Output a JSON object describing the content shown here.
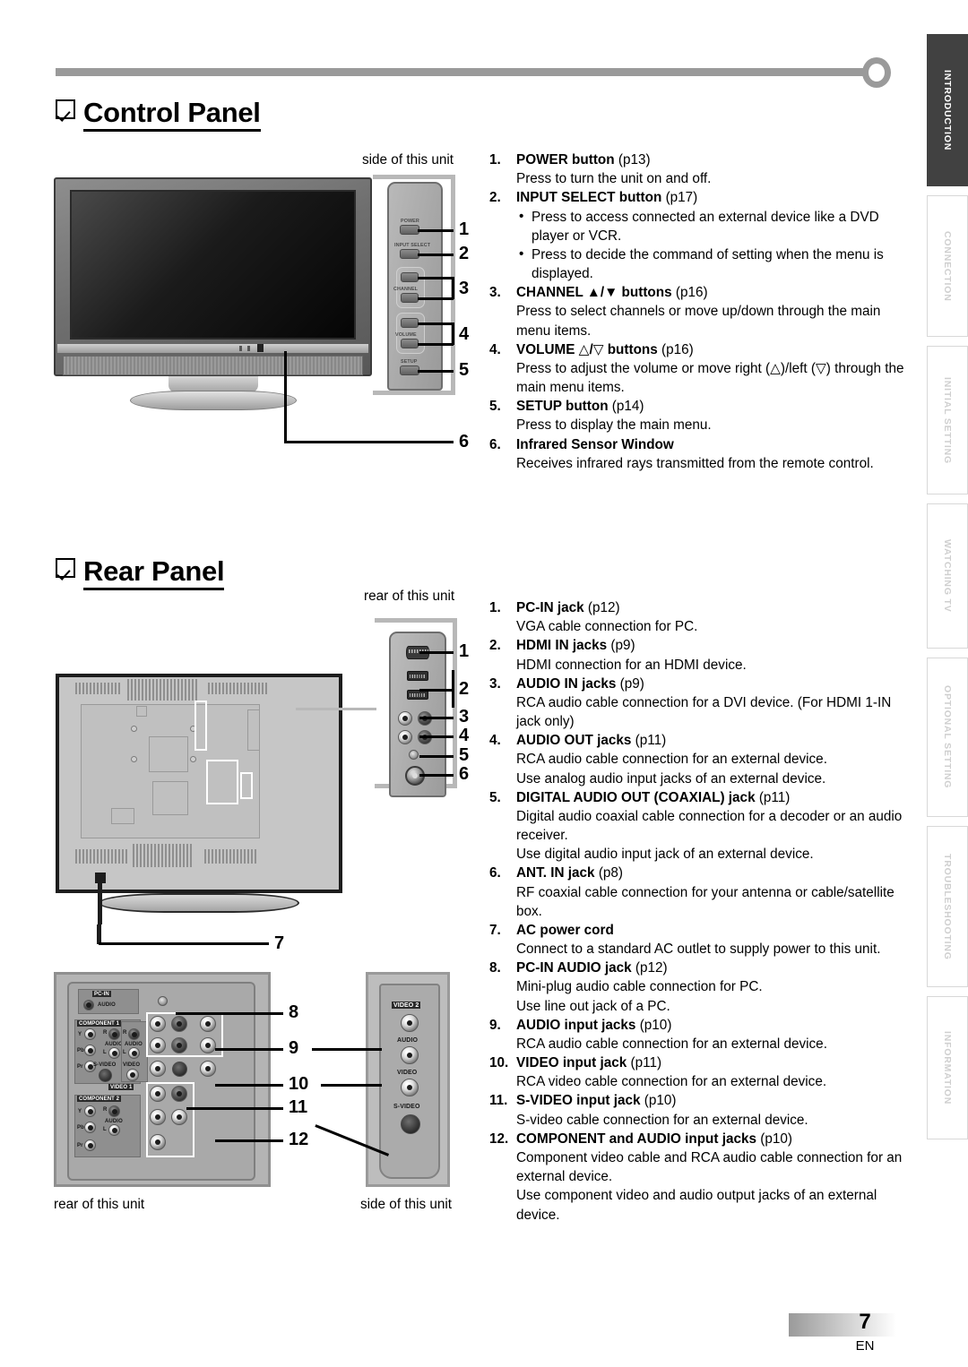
{
  "document": {
    "page_number": "7",
    "language_code": "EN"
  },
  "side_tabs": [
    {
      "label": "INTRODUCTION",
      "active": true
    },
    {
      "label": "CONNECTION",
      "active": false
    },
    {
      "label": "INITIAL  SETTING",
      "active": false
    },
    {
      "label": "WATCHING  TV",
      "active": false
    },
    {
      "label": "OPTIONAL  SETTING",
      "active": false
    },
    {
      "label": "TROUBLESHOOTING",
      "active": false
    },
    {
      "label": "INFORMATION",
      "active": false
    }
  ],
  "control_panel": {
    "heading": "Control Panel",
    "figure_caption": "side of this unit",
    "callouts": [
      "1",
      "2",
      "3",
      "4",
      "5",
      "6"
    ],
    "device_button_labels": {
      "power": "POWER",
      "input_select": "INPUT SELECT",
      "channel": "CHANNEL",
      "volume": "VOLUME",
      "setup": "SETUP"
    },
    "items": [
      {
        "num": "1.",
        "title": "POWER button",
        "page_ref": "(p13)",
        "lines": [
          "Press to turn the unit on and off."
        ]
      },
      {
        "num": "2.",
        "title": "INPUT SELECT button",
        "page_ref": "(p17)",
        "bullets": [
          "Press to access connected an external device like a DVD player or VCR.",
          "Press to decide the command of setting when the menu is displayed."
        ]
      },
      {
        "num": "3.",
        "title": "CHANNEL ▲/▼ buttons",
        "page_ref": "(p16)",
        "lines": [
          "Press to select channels or move up/down through the main menu items."
        ]
      },
      {
        "num": "4.",
        "title": "VOLUME △/▽ buttons",
        "page_ref": "(p16)",
        "lines": [
          "Press to adjust the volume or move right (△)/left (▽) through the main menu items."
        ]
      },
      {
        "num": "5.",
        "title": "SETUP button",
        "page_ref": "(p14)",
        "lines": [
          "Press to display the main menu."
        ]
      },
      {
        "num": "6.",
        "title": "Infrared Sensor Window",
        "page_ref": "",
        "lines": [
          "Receives infrared rays transmitted from the remote control."
        ]
      }
    ]
  },
  "rear_panel": {
    "heading": "Rear Panel",
    "figure_caption_top": "rear of this unit",
    "figure_caption_bottom_left": "rear of this unit",
    "figure_caption_bottom_right": "side of this unit",
    "callouts_top": [
      "1",
      "2",
      "3",
      "4",
      "5",
      "6",
      "7"
    ],
    "callouts_bottom": [
      "8",
      "9",
      "10",
      "11",
      "12"
    ],
    "jack_labels": {
      "pc_in": "PC-IN",
      "pc_in_audio": "AUDIO",
      "component1": "COMPONENT 1",
      "component2": "COMPONENT 2",
      "y": "Y",
      "pb": "Pb",
      "pr": "Pr",
      "audio": "AUDIO",
      "r": "R",
      "l": "L",
      "s_video": "S-VIDEO",
      "video": "VIDEO",
      "video1": "VIDEO 1",
      "video2": "VIDEO 2"
    },
    "items": [
      {
        "num": "1.",
        "title": "PC-IN jack",
        "page_ref": "(p12)",
        "lines": [
          "VGA cable connection for PC."
        ]
      },
      {
        "num": "2.",
        "title": "HDMI IN jacks",
        "page_ref": "(p9)",
        "lines": [
          "HDMI connection for an HDMI device."
        ]
      },
      {
        "num": "3.",
        "title": "AUDIO IN jacks",
        "page_ref": "(p9)",
        "lines": [
          "RCA audio cable connection for a DVI device. (For HDMI 1-IN jack only)"
        ]
      },
      {
        "num": "4.",
        "title": "AUDIO OUT jacks",
        "page_ref": "(p11)",
        "lines": [
          "RCA audio cable connection for an external device.",
          "Use analog audio input jacks of an external device."
        ]
      },
      {
        "num": "5.",
        "title": "DIGITAL AUDIO OUT (COAXIAL) jack",
        "page_ref": "(p11)",
        "lines": [
          "Digital audio coaxial cable connection for a decoder or an audio receiver.",
          "Use digital audio input jack of an external device."
        ]
      },
      {
        "num": "6.",
        "title": "ANT. IN jack",
        "page_ref": "(p8)",
        "lines": [
          "RF coaxial cable connection for your antenna or cable/satellite box."
        ]
      },
      {
        "num": "7.",
        "title": "AC power cord",
        "page_ref": "",
        "lines": [
          "Connect to a standard AC outlet to supply power to this unit."
        ]
      },
      {
        "num": "8.",
        "title": "PC-IN AUDIO jack",
        "page_ref": "(p12)",
        "lines": [
          "Mini-plug audio cable connection for PC.",
          "Use line out jack of a PC."
        ]
      },
      {
        "num": "9.",
        "title": "AUDIO input jacks",
        "page_ref": "(p10)",
        "lines": [
          "RCA audio cable connection for an external device."
        ]
      },
      {
        "num": "10.",
        "title": "VIDEO input jack",
        "page_ref": "(p11)",
        "lines": [
          "RCA video cable connection for an external device."
        ]
      },
      {
        "num": "11.",
        "title": "S-VIDEO input jack",
        "page_ref": "(p10)",
        "lines": [
          "S-video cable connection for an external device."
        ]
      },
      {
        "num": "12.",
        "title": "COMPONENT and AUDIO input jacks",
        "page_ref": "(p10)",
        "lines": [
          "Component video cable and RCA audio cable connection for an external device.",
          "Use component video and audio output jacks of an external device."
        ]
      }
    ]
  }
}
